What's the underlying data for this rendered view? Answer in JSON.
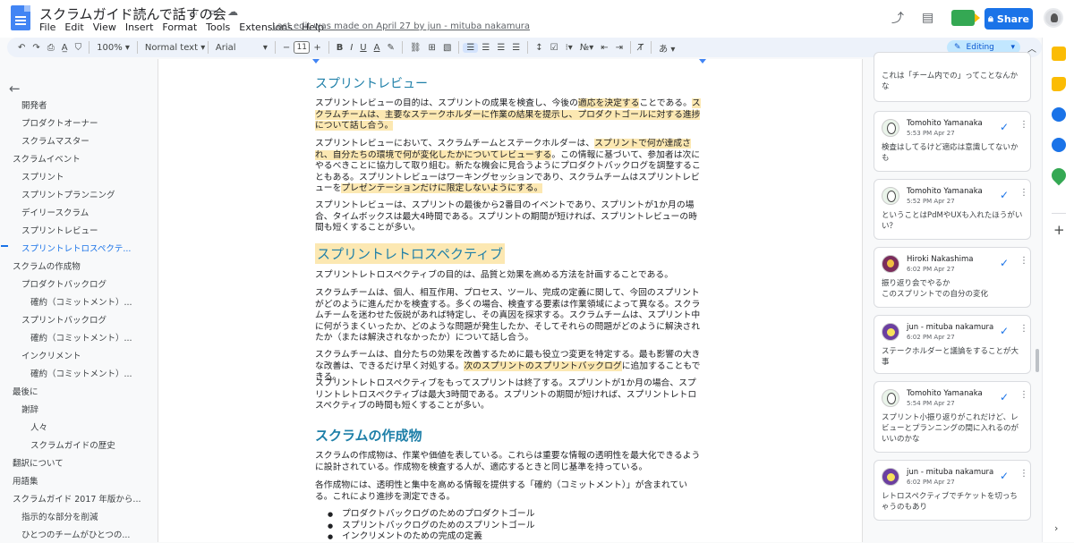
{
  "doc": {
    "title": "スクラムガイド読んで話すの会",
    "menu": [
      "File",
      "Edit",
      "View",
      "Insert",
      "Format",
      "Tools",
      "Extensions",
      "Help"
    ],
    "last_edit": "Last edit was made on April 27 by jun - mituba nakamura",
    "share_label": "Share"
  },
  "toolbar": {
    "zoom": "100%",
    "style": "Normal text",
    "font": "Arial",
    "font_size": "11",
    "editing_label": "Editing",
    "minus": "−",
    "plus": "+",
    "bold": "B",
    "italic": "I",
    "underline": "U",
    "text_color": "A",
    "input_tools": "あ"
  },
  "outline": {
    "items": [
      {
        "label": "開発者",
        "level": 2
      },
      {
        "label": "プロダクトオーナー",
        "level": 2
      },
      {
        "label": "スクラムマスター",
        "level": 2
      },
      {
        "label": "スクラムイベント",
        "level": 1
      },
      {
        "label": "スプリント",
        "level": 2
      },
      {
        "label": "スプリントプランニング",
        "level": 2
      },
      {
        "label": "デイリースクラム",
        "level": 2
      },
      {
        "label": "スプリントレビュー",
        "level": 2
      },
      {
        "label": "スプリントレトロスペクテ...",
        "level": 2,
        "active": true
      },
      {
        "label": "スクラムの作成物",
        "level": 1
      },
      {
        "label": "プロダクトバックログ",
        "level": 2
      },
      {
        "label": "確約（コミットメント）...",
        "level": 3
      },
      {
        "label": "スプリントバックログ",
        "level": 2
      },
      {
        "label": "確約（コミットメント）...",
        "level": 3
      },
      {
        "label": "インクリメント",
        "level": 2
      },
      {
        "label": "確約（コミットメント）...",
        "level": 3
      },
      {
        "label": "最後に",
        "level": 1
      },
      {
        "label": "謝辞",
        "level": 2
      },
      {
        "label": "人々",
        "level": 3
      },
      {
        "label": "スクラムガイドの歴史",
        "level": 3
      },
      {
        "label": "翻訳について",
        "level": 1
      },
      {
        "label": "用語集",
        "level": 1
      },
      {
        "label": "スクラムガイド 2017 年版から...",
        "level": 1
      },
      {
        "label": "指示的な部分を削減",
        "level": 2
      },
      {
        "label": "ひとつのチームがひとつの...",
        "level": 2
      }
    ]
  },
  "content": {
    "h_review": "スプリントレビュー",
    "p1_a": "スプリントレビューの目的は、スプリントの成果を検査し、今後の",
    "p1_b": "適応を決定する",
    "p1_c": "ことである。",
    "p1_d": "スクラムチームは、主要なステークホルダーに作業の結果を提示し、プロダクトゴールに対する進捗について話し合う。",
    "p2_a": "スプリントレビューにおいて、スクラムチームとステークホルダーは、",
    "p2_b": "スプリントで何が達成され、自分たちの環境で何が変化したかについてレビューする",
    "p2_c": "。この情報に基づいて、参加者は次にやるべきことに協力して取り組む。新たな機会に見合うようにプロダクトバックログを調整することもある。スプリントレビューはワーキングセッションであり、スクラムチームはスプリントレビューを",
    "p2_d": "プレゼンテーションだけに限定しないようにする。",
    "p3": "スプリントレビューは、スプリントの最後から2番目のイベントであり、スプリントが1か月の場合、タイムボックスは最大4時間である。スプリントの期間が短ければ、スプリントレビューの時間も短くすることが多い。",
    "h_retro": "スプリントレトロスペクティブ",
    "p4": "スプリントレトロスペクティブの目的は、品質と効果を高める方法を計画することである。",
    "p5": "スクラムチームは、個人、相互作用、プロセス、ツール、完成の定義に関して、今回のスプリントがどのように進んだかを検査する。多くの場合、検査する要素は作業領域によって異なる。スクラムチームを迷わせた仮説があれば特定し、その真因を探求する。スクラムチームは、スプリント中に何がうまくいったか、どのような問題が発生したか、そしてそれらの問題がどのように解決されたか（または解決されなかったか）について話し合う。",
    "p6_a": "スクラムチームは、自分たちの効果を改善するために最も役立つ変更を特定する。最も影響の大きな改善は、できるだけ早く対処する。",
    "p6_b": "次のスプリントのスプリントバックログ",
    "p6_c": "に追加することもできる。",
    "p7": "スプリントレトロスペクティブをもってスプリントは終了する。スプリントが1か月の場合、スプリントレトロスペクティブは最大3時間である。スプリントの期間が短ければ、スプリントレトロスペクティブの時間も短くすることが多い。",
    "h_artifacts": "スクラムの作成物",
    "p8": "スクラムの作成物は、作業や価値を表している。これらは重要な情報の透明性を最大化できるように設計されている。作成物を検査する人が、適応するときと同じ基準を持っている。",
    "p9": "各作成物には、透明性と集中を高める情報を提供する「確約（コミットメント）」が含まれている。これにより進捗を測定できる。",
    "bullets": [
      "プロダクトバックログのためのプロダクトゴール",
      "スプリントバックログのためのスプリントゴール",
      "インクリメントのための完成の定義"
    ]
  },
  "comments": [
    {
      "author": "",
      "time": "",
      "text": "これは「チーム内での」ってことなんかな",
      "avatar": "tom"
    },
    {
      "author": "Tomohito Yamanaka",
      "time": "5:53 PM Apr 27",
      "text": "検査はしてるけど適応は意識してないかも",
      "avatar": "tom"
    },
    {
      "author": "Tomohito Yamanaka",
      "time": "5:52 PM Apr 27",
      "text": "ということはPdMやUXも入れたほうがいい？",
      "avatar": "tom"
    },
    {
      "author": "Hiroki Nakashima",
      "time": "6:02 PM Apr 27",
      "text": "振り返り会でやるか\nこのスプリントでの自分の変化",
      "avatar": "hiro"
    },
    {
      "author": "jun - mituba nakamura",
      "time": "6:02 PM Apr 27",
      "text": "ステークホルダーと議論をすることが大事",
      "avatar": "jun"
    },
    {
      "author": "Tomohito Yamanaka",
      "time": "5:54 PM Apr 27",
      "text": "スプリント小振り返りがこれだけど、レビューとプランニングの間に入れるのがいいのかな",
      "avatar": "tom"
    },
    {
      "author": "jun - mituba nakamura",
      "time": "6:02 PM Apr 27",
      "text": "レトロスペクティブでチケットを切っちゃうのもあり",
      "avatar": "jun"
    }
  ],
  "colors": {
    "accent": "#1a73e8",
    "heading": "#1e7fa8",
    "highlight": "#fce8b2"
  }
}
